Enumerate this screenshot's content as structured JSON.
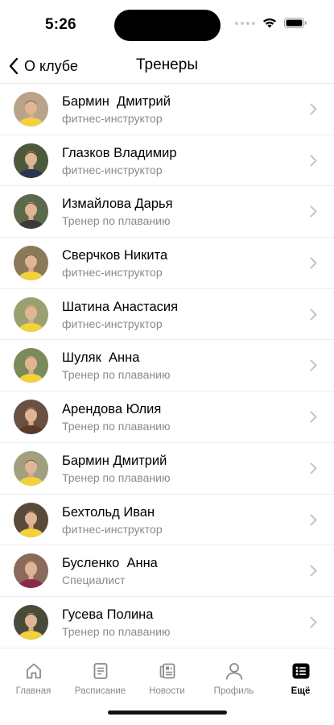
{
  "status_bar": {
    "time": "5:26"
  },
  "nav": {
    "back_label": "О клубе",
    "title": "Тренеры"
  },
  "trainers": [
    {
      "name": "Бармин  Дмитрий",
      "role": "фитнес-инструктор",
      "shirt": "#f2d23b",
      "hair": "#6b4a2e"
    },
    {
      "name": "Глазков Владимир",
      "role": "фитнес-инструктор",
      "shirt": "#2c3550",
      "hair": "#3a2a1f"
    },
    {
      "name": "Измайлова Дарья",
      "role": "Тренер по плаванию",
      "shirt": "#3d3a36",
      "hair": "#5a3a22"
    },
    {
      "name": "Сверчков Никита",
      "role": "фитнес-инструктор",
      "shirt": "#f2d23b",
      "hair": "#2e2218"
    },
    {
      "name": "Шатина Анастасия",
      "role": "фитнес-инструктор",
      "shirt": "#f2d23b",
      "hair": "#c89a5a"
    },
    {
      "name": "Шуляк  Анна",
      "role": "Тренер по плаванию",
      "shirt": "#f2d23b",
      "hair": "#b88a52"
    },
    {
      "name": "Арендова Юлия",
      "role": "Тренер по плаванию",
      "shirt": "#5a3a2a",
      "hair": "#6a3f22"
    },
    {
      "name": "Бармин Дмитрий",
      "role": "Тренер по плаванию",
      "shirt": "#f2d23b",
      "hair": "#5a3f28"
    },
    {
      "name": "Бехтольд Иван",
      "role": "фитнес-инструктор",
      "shirt": "#f2d23b",
      "hair": "#2a2018"
    },
    {
      "name": "Бусленко  Анна",
      "role": "Специалист",
      "shirt": "#8a2a4a",
      "hair": "#c4a070"
    },
    {
      "name": "Гусева Полина",
      "role": "Тренер по плаванию",
      "shirt": "#f2d23b",
      "hair": "#2e2218"
    }
  ],
  "tabs": [
    {
      "label": "Главная",
      "icon": "home-icon",
      "active": false
    },
    {
      "label": "Расписание",
      "icon": "schedule-icon",
      "active": false
    },
    {
      "label": "Новости",
      "icon": "news-icon",
      "active": false
    },
    {
      "label": "Профиль",
      "icon": "profile-icon",
      "active": false
    },
    {
      "label": "Ещё",
      "icon": "more-list-icon",
      "active": true
    }
  ],
  "colors": {
    "accent_yellow": "#f2d23b",
    "secondary_text": "#8a8a8e",
    "chevron": "#c4c4c7"
  }
}
